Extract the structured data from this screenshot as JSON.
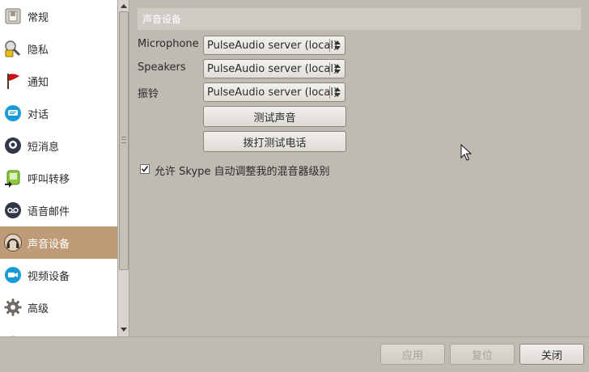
{
  "sidebar": {
    "items": [
      {
        "label": "常规",
        "icon": "switch-icon"
      },
      {
        "label": "隐私",
        "icon": "privacy-icon"
      },
      {
        "label": "通知",
        "icon": "flag-icon"
      },
      {
        "label": "对话",
        "icon": "chat-icon"
      },
      {
        "label": "短消息",
        "icon": "sms-icon"
      },
      {
        "label": "呼叫转移",
        "icon": "call-forward-icon"
      },
      {
        "label": "语音邮件",
        "icon": "voicemail-icon"
      },
      {
        "label": "声音设备",
        "icon": "headset-icon"
      },
      {
        "label": "视频设备",
        "icon": "video-icon"
      },
      {
        "label": "高级",
        "icon": "gear-icon"
      }
    ],
    "selected_index": 7
  },
  "main": {
    "section_title": "声音设备",
    "microphone": {
      "label": "Microphone",
      "value": "PulseAudio server (local)"
    },
    "speakers": {
      "label": "Speakers",
      "value": "PulseAudio server (local)"
    },
    "ringing": {
      "label": "振铃",
      "value": "PulseAudio server (local)"
    },
    "test_sound_button": "测试声音",
    "test_call_button": "拨打测试电话",
    "auto_adjust": {
      "label": "允许 Skype 自动调整我的混音器级别",
      "checked": true
    }
  },
  "footer": {
    "apply": "应用",
    "reset": "复位",
    "close": "关闭"
  },
  "colors": {
    "selected_bg": "#bf9b78",
    "window_bg": "#bfbab2",
    "header_bg": "#cfcbc4"
  }
}
